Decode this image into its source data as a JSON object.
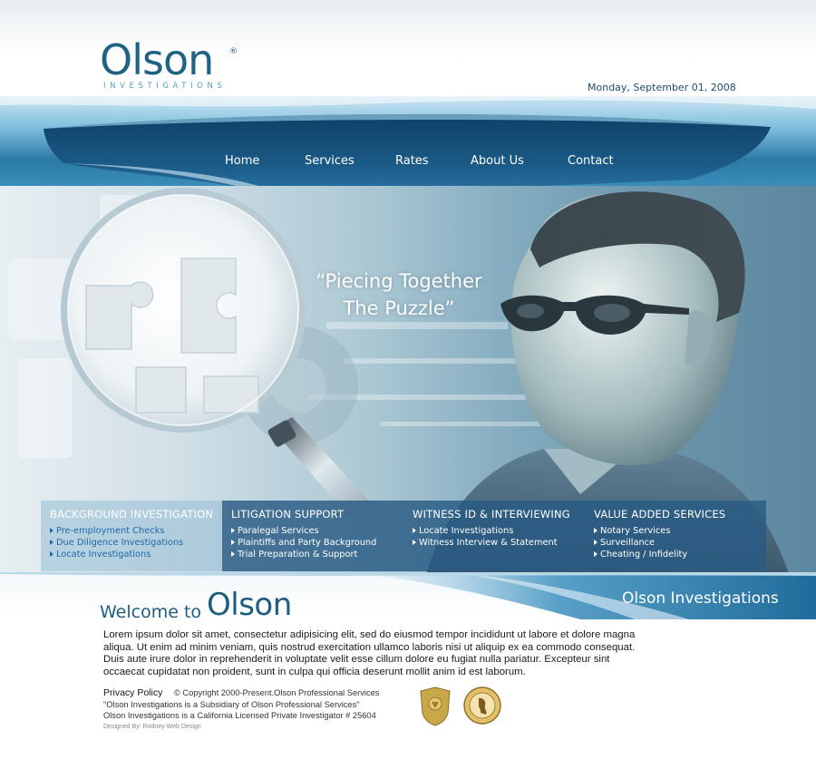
{
  "header": {
    "logo_text": "Olson",
    "logo_registered": "®",
    "logo_subtitle": "INVESTIGATIONS",
    "date": "Monday, September 01, 2008"
  },
  "nav": {
    "items": [
      {
        "label": "Home"
      },
      {
        "label": "Services"
      },
      {
        "label": "Rates"
      },
      {
        "label": "About Us"
      },
      {
        "label": "Contact"
      }
    ]
  },
  "hero": {
    "tagline_line1": "“Piecing Together",
    "tagline_line2": "The Puzzle”"
  },
  "services": {
    "columns": [
      {
        "title": "BACKGROUND INVESTIGATION",
        "items": [
          "Pre-employment Checks",
          "Due Diligence Investigations",
          "Locate Investigations"
        ]
      },
      {
        "title": "LITIGATION SUPPORT",
        "items": [
          "Paralegal Services",
          "Plaintiffs and Party Background",
          "Trial Preparation & Support"
        ]
      },
      {
        "title": "WITNESS ID & INTERVIEWING",
        "items": [
          "Locate Investigations",
          "Witness Interview & Statement"
        ]
      },
      {
        "title": "VALUE ADDED SERVICES",
        "items": [
          "Notary Services",
          "Surveillance",
          "Cheating / Infidelity"
        ]
      }
    ]
  },
  "welcome": {
    "welcome_to": "Welcome to",
    "olson": "Olson",
    "band_title": "Olson Investigations"
  },
  "body": {
    "text": "Lorem ipsum dolor sit amet, consectetur adipisicing elit, sed do eiusmod tempor incididunt ut labore et dolore magna aliqua. Ut enim ad minim veniam, quis nostrud exercitation ullamco laboris nisi ut aliquip ex ea commodo consequat. Duis aute irure dolor in reprehenderit in voluptate velit esse cillum dolore eu fugiat nulla pariatur. Excepteur sint occaecat cupidatat non proident, sunt in culpa qui officia deserunt mollit anim id est laborum."
  },
  "footer": {
    "privacy": "Privacy Policy",
    "copyright": "© Copyright 2000-Present.Olson Professional Services",
    "subsidiary": "\"Olson Investigations is a Subsidiary of Olson Professional Services\"",
    "license": "Olson Investigations is a California Licensed Private Investigator # 25604",
    "designed": "Designed By: Rodney Web Design"
  },
  "colors": {
    "brand_blue": "#1f6384",
    "nav_band": "#2b7aa6",
    "service_panel_light": "#6d9fbf",
    "service_panel_dark": "#2e5f86",
    "link_blue": "#1e6aa8"
  }
}
